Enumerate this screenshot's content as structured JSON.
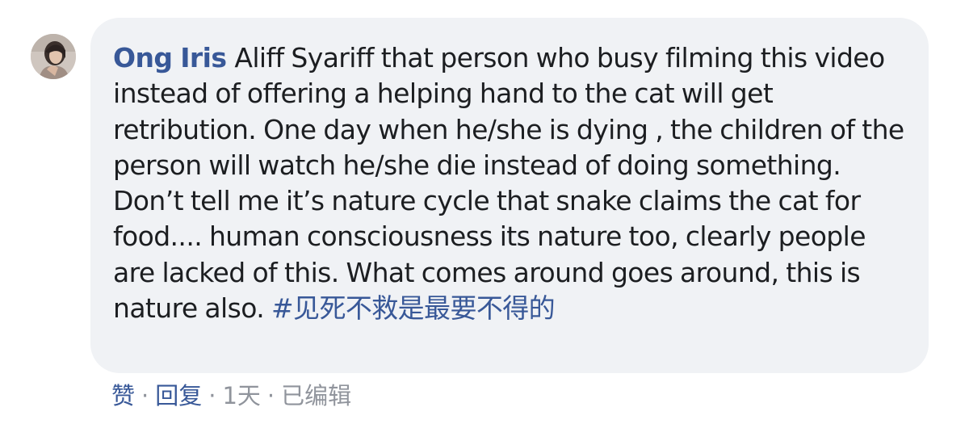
{
  "comment": {
    "author": "Ong Iris",
    "text": "Aliff Syariff that person who busy filming this video instead of offering a helping hand to the cat will get retribution. One day when he/she is dying , the children of the person will watch he/she die instead of doing something. Don’t tell me it’s nature cycle that snake claims the cat for food.... human consciousness its nature too, clearly people are lacked of this. What comes around goes around, this is nature also.",
    "hashtag": "#见死不救是最要不得的"
  },
  "actions": {
    "like_label": "赞",
    "reply_label": "回复",
    "separator": "·",
    "timestamp": "1天",
    "edited_label": "已编辑"
  },
  "colors": {
    "link": "#385898",
    "text": "#1c1e21",
    "meta": "#90949c",
    "bubble": "#f0f2f5"
  },
  "icons": {
    "avatar": "user-avatar-photo"
  }
}
